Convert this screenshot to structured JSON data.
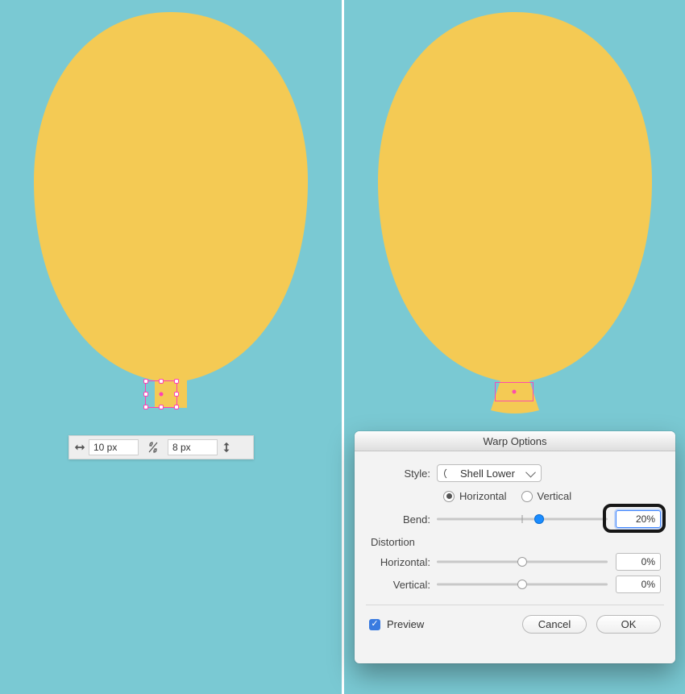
{
  "colors": {
    "canvas_bg": "#7ac9d3",
    "balloon": "#f4ca54",
    "selection": "#ff3fb6",
    "dialog_bg": "#f3f3f3",
    "accent_blue": "#1a8cff",
    "highlight_frame": "#161616"
  },
  "toolbar": {
    "width_value": "10 px",
    "height_value": "8 px",
    "link_icon": "link-broken-icon",
    "width_icon": "width-arrows-icon",
    "height_icon": "height-arrows-icon"
  },
  "dialog": {
    "title": "Warp Options",
    "style_label": "Style:",
    "style_value": "Shell Lower",
    "orientation": {
      "horizontal_label": "Horizontal",
      "vertical_label": "Vertical",
      "selected": "horizontal"
    },
    "bend": {
      "label": "Bend:",
      "value": "20%",
      "slider_pos_pct": 60
    },
    "distortion": {
      "group_label": "Distortion",
      "horizontal_label": "Horizontal:",
      "horizontal_value": "0%",
      "horizontal_slider_pos_pct": 50,
      "vertical_label": "Vertical:",
      "vertical_value": "0%",
      "vertical_slider_pos_pct": 50
    },
    "preview_label": "Preview",
    "preview_checked": true,
    "cancel_label": "Cancel",
    "ok_label": "OK"
  }
}
